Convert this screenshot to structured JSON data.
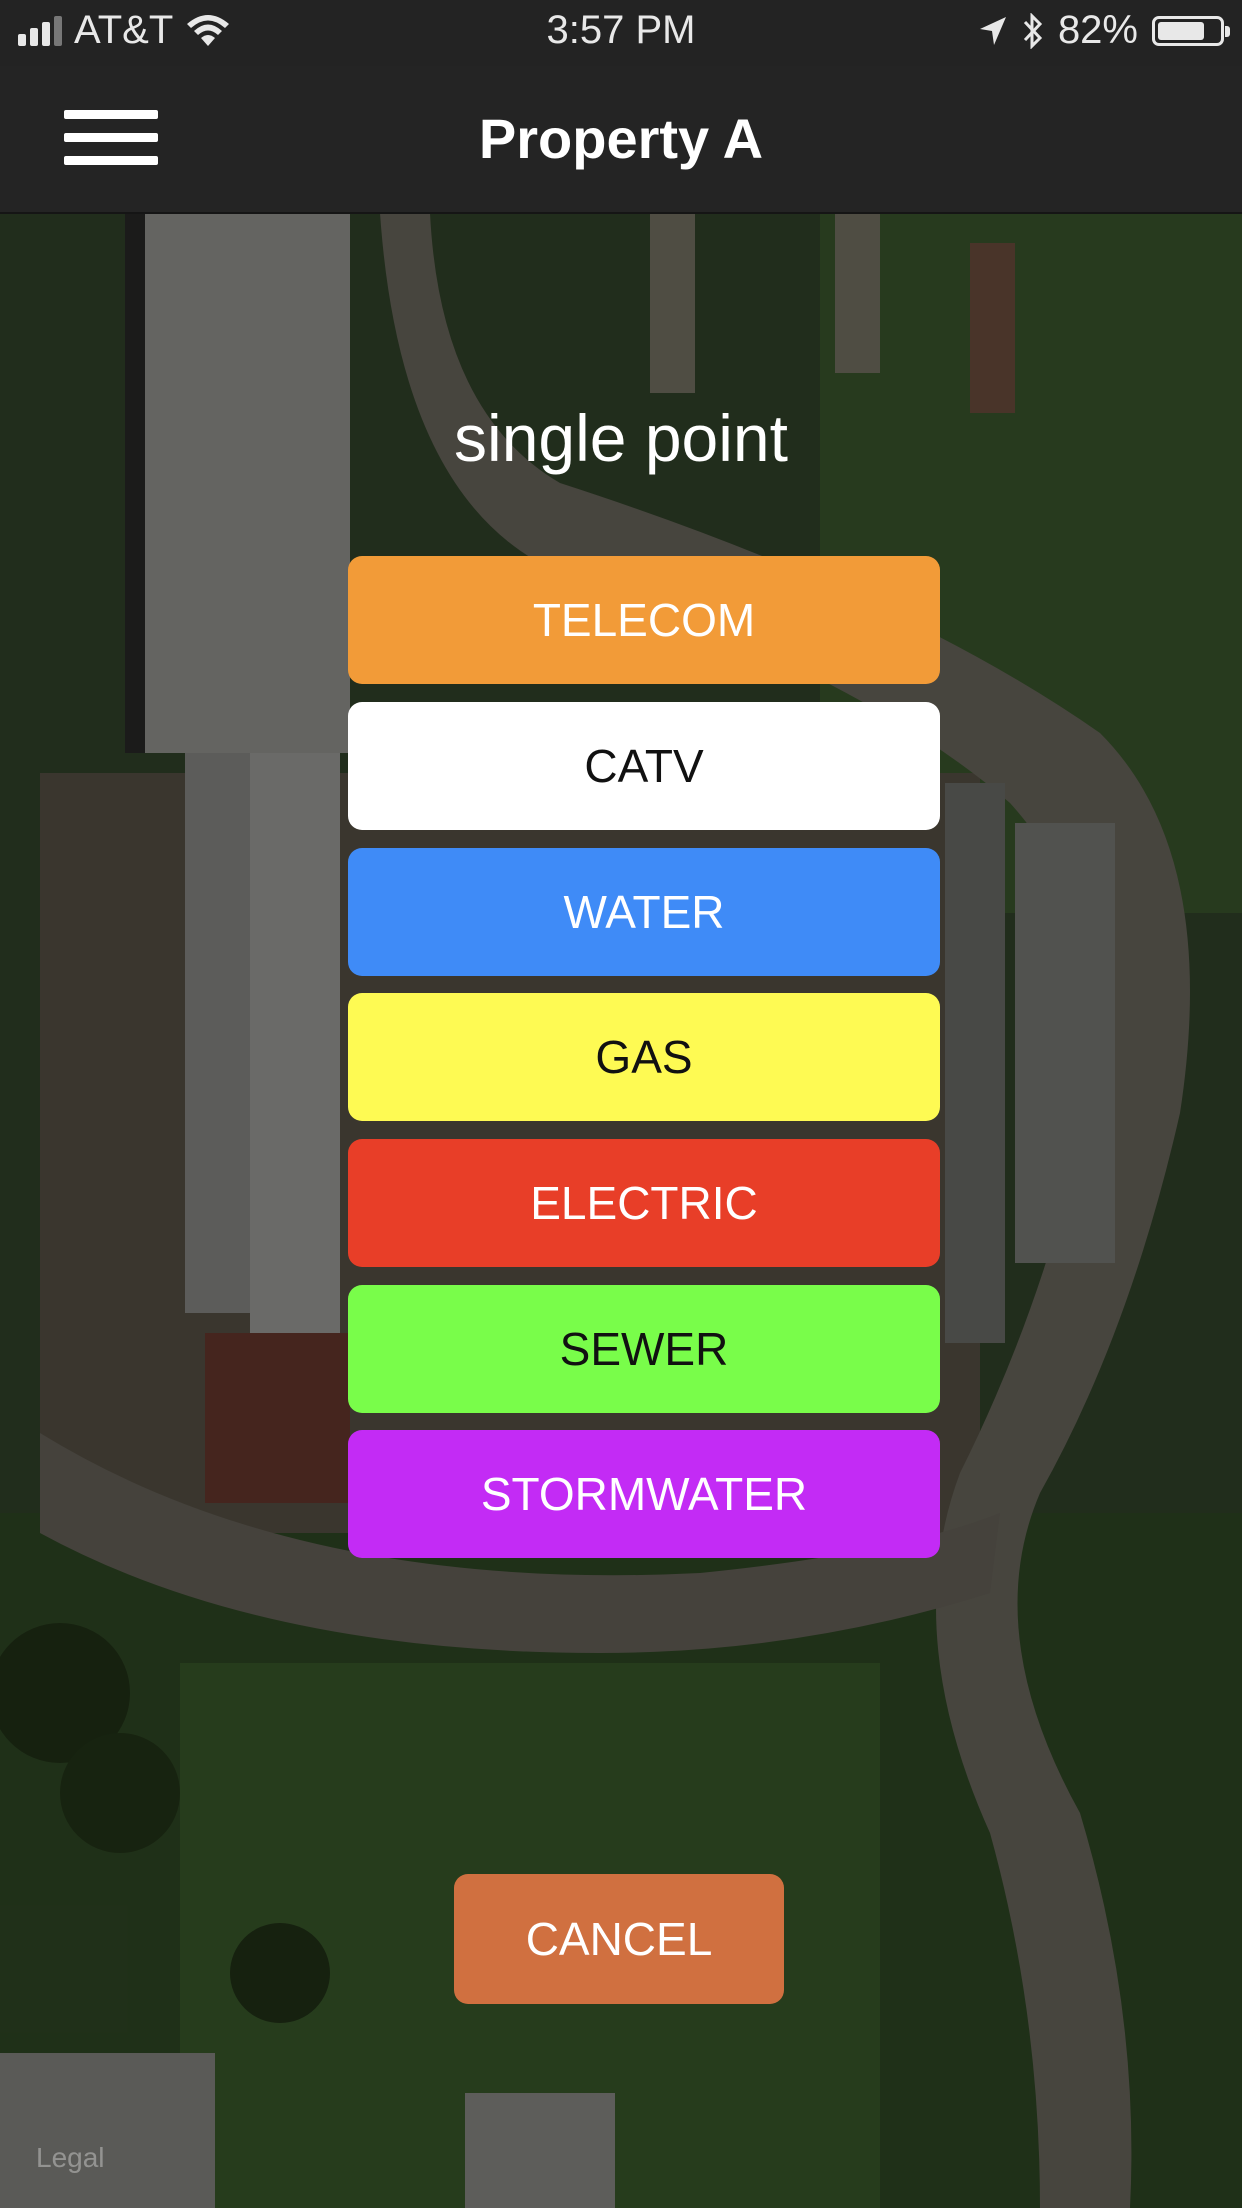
{
  "status_bar": {
    "carrier": "AT&T",
    "time": "3:57 PM",
    "battery": "82%",
    "battery_level": 0.82,
    "icons": [
      "signal-icon",
      "wifi-icon",
      "location-arrow-icon",
      "bluetooth-icon",
      "battery-icon"
    ]
  },
  "nav": {
    "title": "Property A",
    "menu_icon": "hamburger-menu-icon"
  },
  "chooser": {
    "title": "single point",
    "options": [
      {
        "label": "TELECOM",
        "bg": "#f29b38",
        "fg": "#ffffff"
      },
      {
        "label": "CATV",
        "bg": "#ffffff",
        "fg": "#111111"
      },
      {
        "label": "WATER",
        "bg": "#3f8bf7",
        "fg": "#ffffff"
      },
      {
        "label": "GAS",
        "bg": "#fefa53",
        "fg": "#111111"
      },
      {
        "label": "ELECTRIC",
        "bg": "#e83e28",
        "fg": "#ffffff"
      },
      {
        "label": "SEWER",
        "bg": "#79fd4a",
        "fg": "#111111"
      },
      {
        "label": "STORMWATER",
        "bg": "#c32bf5",
        "fg": "#ffffff"
      }
    ],
    "cancel_label": "CANCEL",
    "cancel_color": "#d07040"
  },
  "map": {
    "legal_label": "Legal"
  }
}
